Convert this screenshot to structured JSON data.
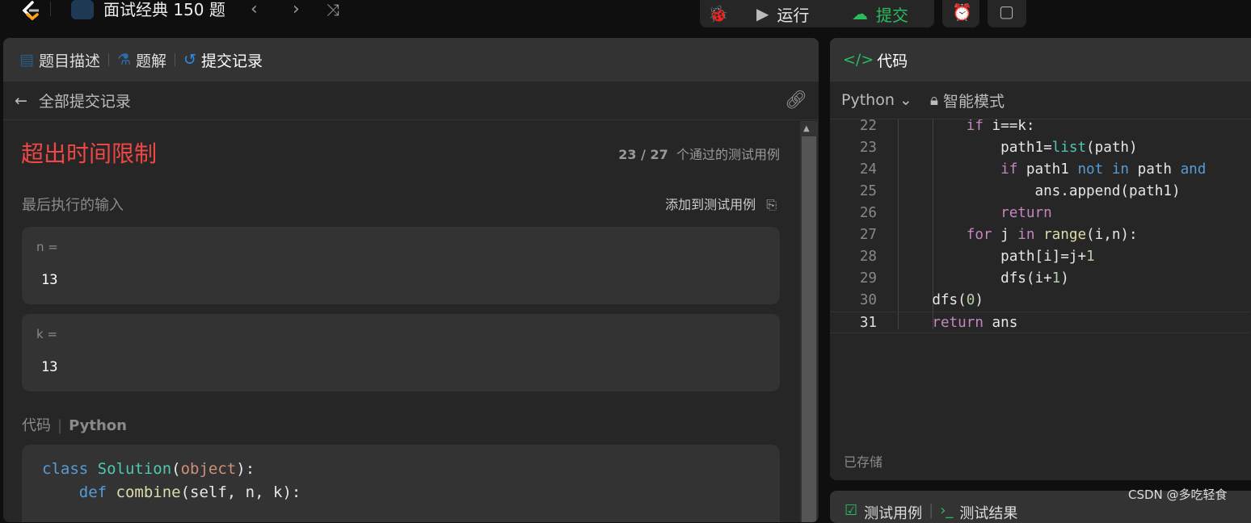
{
  "topbar": {
    "title": "面试经典 150 题",
    "run_label": "运行",
    "submit_label": "提交",
    "accent_submit": "#2cbb5d"
  },
  "left": {
    "tabs": [
      {
        "label": "题目描述",
        "icon": "document-icon"
      },
      {
        "label": "题解",
        "icon": "flask-icon"
      },
      {
        "label": "提交记录",
        "icon": "history-icon"
      }
    ],
    "back_label": "全部提交记录",
    "status": "超出时间限制",
    "status_color": "#ef4743",
    "passed": "23 / 27",
    "passed_suffix": "个通过的测试用例",
    "last_input_label": "最后执行的输入",
    "add_testcase_label": "添加到测试用例",
    "inputs": [
      {
        "name": "n =",
        "value": "13"
      },
      {
        "name": "k =",
        "value": "13"
      }
    ],
    "code_label": "代码",
    "code_lang": "Python",
    "code_lines": [
      [
        [
          "class ",
          "kb"
        ],
        [
          "Solution",
          "cls"
        ],
        [
          "(",
          "tx"
        ],
        [
          "object",
          "str"
        ],
        [
          "):",
          "tx"
        ]
      ],
      [
        [
          "    ",
          "tx"
        ],
        [
          "def ",
          "kb"
        ],
        [
          "combine",
          "fn"
        ],
        [
          "(self, n, k):",
          "tx"
        ]
      ]
    ]
  },
  "right": {
    "title": "代码",
    "language": "Python",
    "mode_label": "智能模式",
    "saved_label": "已存储",
    "bottom_tabs": [
      "测试用例",
      "测试结果"
    ],
    "lines": [
      {
        "n": "22",
        "t": [
          [
            "        if ",
            "kw"
          ],
          [
            "i==k:",
            "tx"
          ]
        ]
      },
      {
        "n": "23",
        "t": [
          [
            "            path1=",
            "tx"
          ],
          [
            "list",
            "cls"
          ],
          [
            "(path)",
            "tx"
          ]
        ]
      },
      {
        "n": "24",
        "t": [
          [
            "            if ",
            "kw"
          ],
          [
            "path1 ",
            "tx"
          ],
          [
            "not in ",
            "kb"
          ],
          [
            "path ",
            "tx"
          ],
          [
            "and",
            "kb"
          ]
        ]
      },
      {
        "n": "25",
        "t": [
          [
            "                ans.append(path1)",
            "tx"
          ]
        ]
      },
      {
        "n": "26",
        "t": [
          [
            "            return",
            "kw"
          ]
        ]
      },
      {
        "n": "27",
        "t": [
          [
            "        for ",
            "kw"
          ],
          [
            "j ",
            "tx"
          ],
          [
            "in ",
            "kw"
          ],
          [
            "range",
            "fn"
          ],
          [
            "(i,n):",
            "tx"
          ]
        ]
      },
      {
        "n": "28",
        "t": [
          [
            "            path[i]=j+",
            "tx"
          ],
          [
            "1",
            "num"
          ]
        ]
      },
      {
        "n": "29",
        "t": [
          [
            "            dfs(i+",
            "tx"
          ],
          [
            "1",
            "num"
          ],
          [
            ")",
            "tx"
          ]
        ]
      },
      {
        "n": "30",
        "t": [
          [
            "    dfs(",
            "tx"
          ],
          [
            "0",
            "num"
          ],
          [
            ")",
            "tx"
          ]
        ]
      },
      {
        "n": "31",
        "t": [
          [
            "    return ",
            "kw"
          ],
          [
            "ans",
            "tx"
          ]
        ]
      }
    ]
  },
  "watermark": "CSDN @多吃轻食"
}
